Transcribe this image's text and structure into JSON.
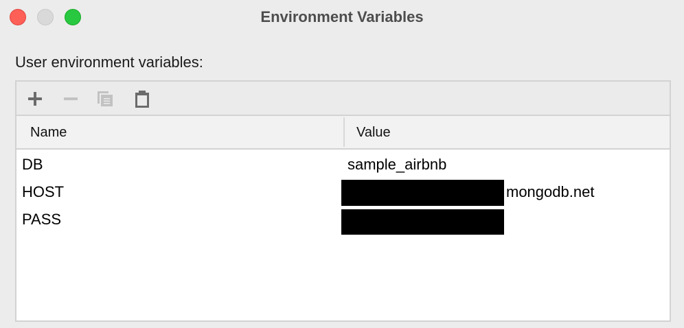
{
  "window": {
    "title": "Environment Variables"
  },
  "label": "User environment variables:",
  "toolbar": {
    "icons": [
      "plus-icon",
      "minus-icon",
      "copy-icon",
      "paste-icon"
    ]
  },
  "table": {
    "headers": {
      "name": "Name",
      "value": "Value"
    },
    "rows": [
      {
        "name": "DB",
        "value": "sample_airbnb"
      },
      {
        "name": "HOST",
        "value": "mongodb.net"
      },
      {
        "name": "PASS",
        "value": ""
      }
    ]
  },
  "colors": {
    "close": "#fe5f57",
    "minimize": "#d9d9d9",
    "zoom": "#28c840"
  }
}
